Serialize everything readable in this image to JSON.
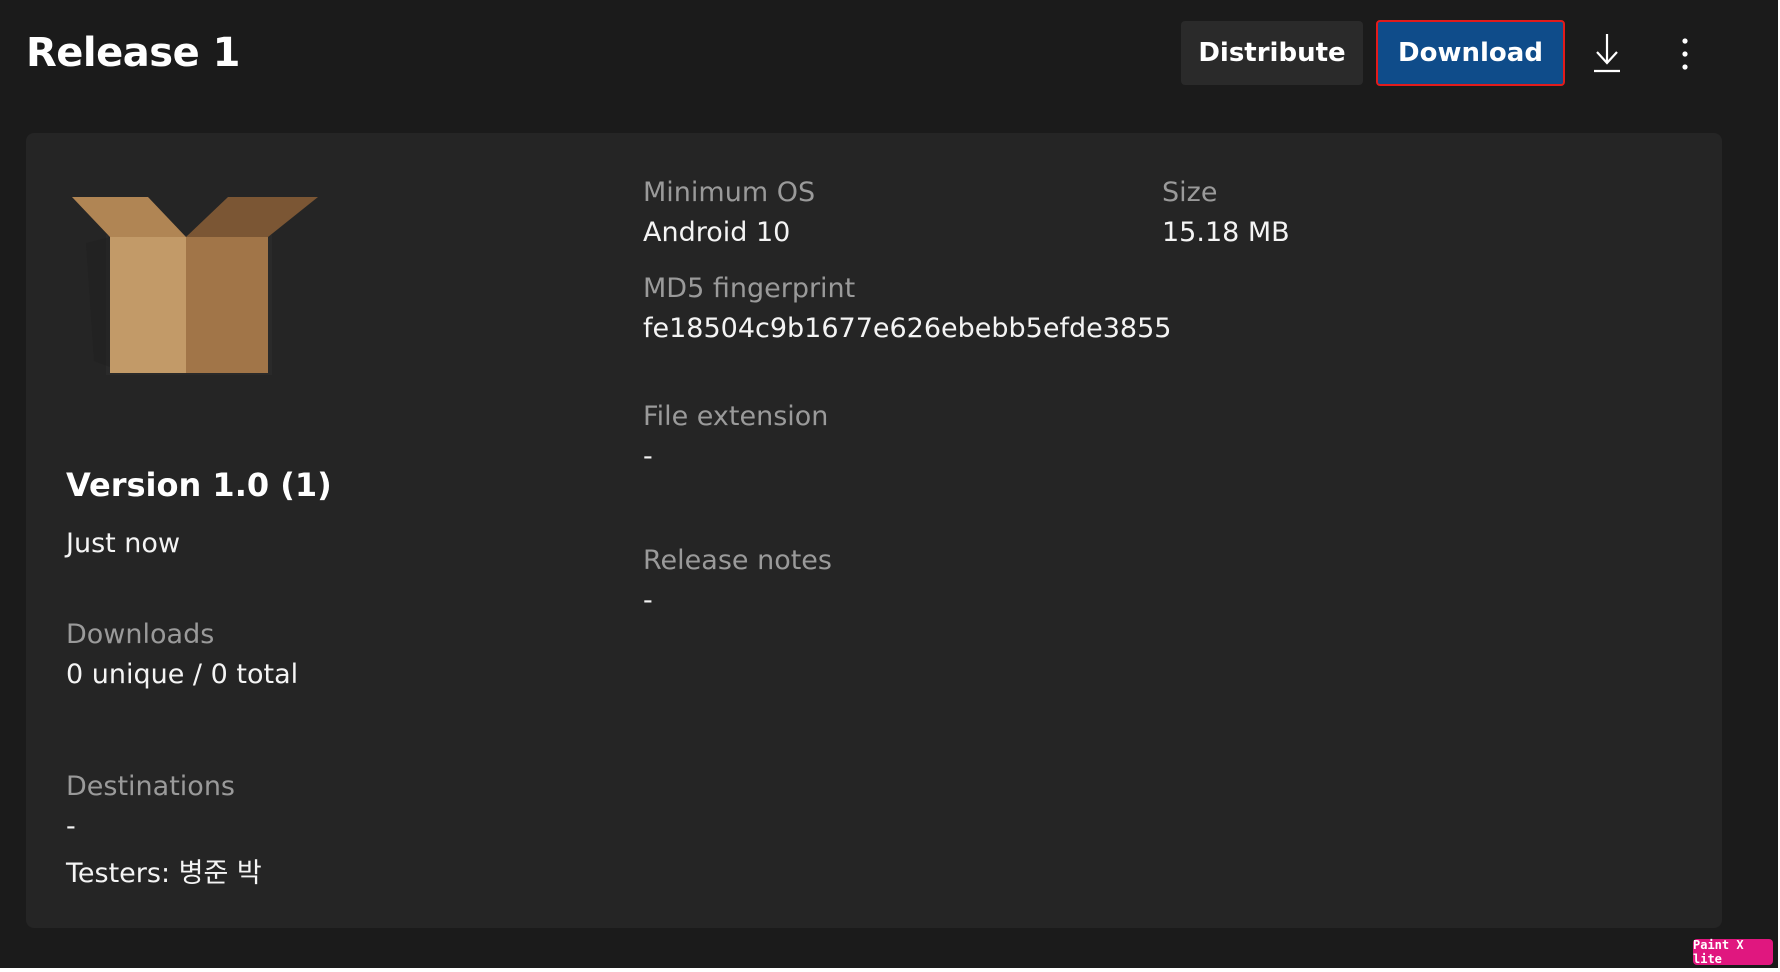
{
  "header": {
    "title": "Release 1",
    "distribute_label": "Distribute",
    "download_label": "Download",
    "download_icon": "download-arrow-icon",
    "more_icon": "more-vertical-icon"
  },
  "release": {
    "icon": "package-box-icon",
    "version": "Version 1.0 (1)",
    "time": "Just now",
    "downloads_label": "Downloads",
    "downloads_value": "0 unique / 0 total",
    "destinations_label": "Destinations",
    "destinations_value": "-",
    "testers": "Testers: 병준 박"
  },
  "details": {
    "min_os_label": "Minimum OS",
    "min_os_value": "Android 10",
    "size_label": "Size",
    "size_value": "15.18 MB",
    "md5_label": "MD5 fingerprint",
    "md5_value": "fe18504c9b1677e626ebebb5efde3855",
    "file_ext_label": "File extension",
    "file_ext_value": "-",
    "release_notes_label": "Release notes",
    "release_notes_value": "-"
  },
  "watermark": "Paint X lite",
  "colors": {
    "background": "#1b1b1b",
    "card": "#252525",
    "primary_button": "#0f4c8a",
    "highlight_border": "#e21b1b",
    "label_text": "#9a9a9a"
  }
}
